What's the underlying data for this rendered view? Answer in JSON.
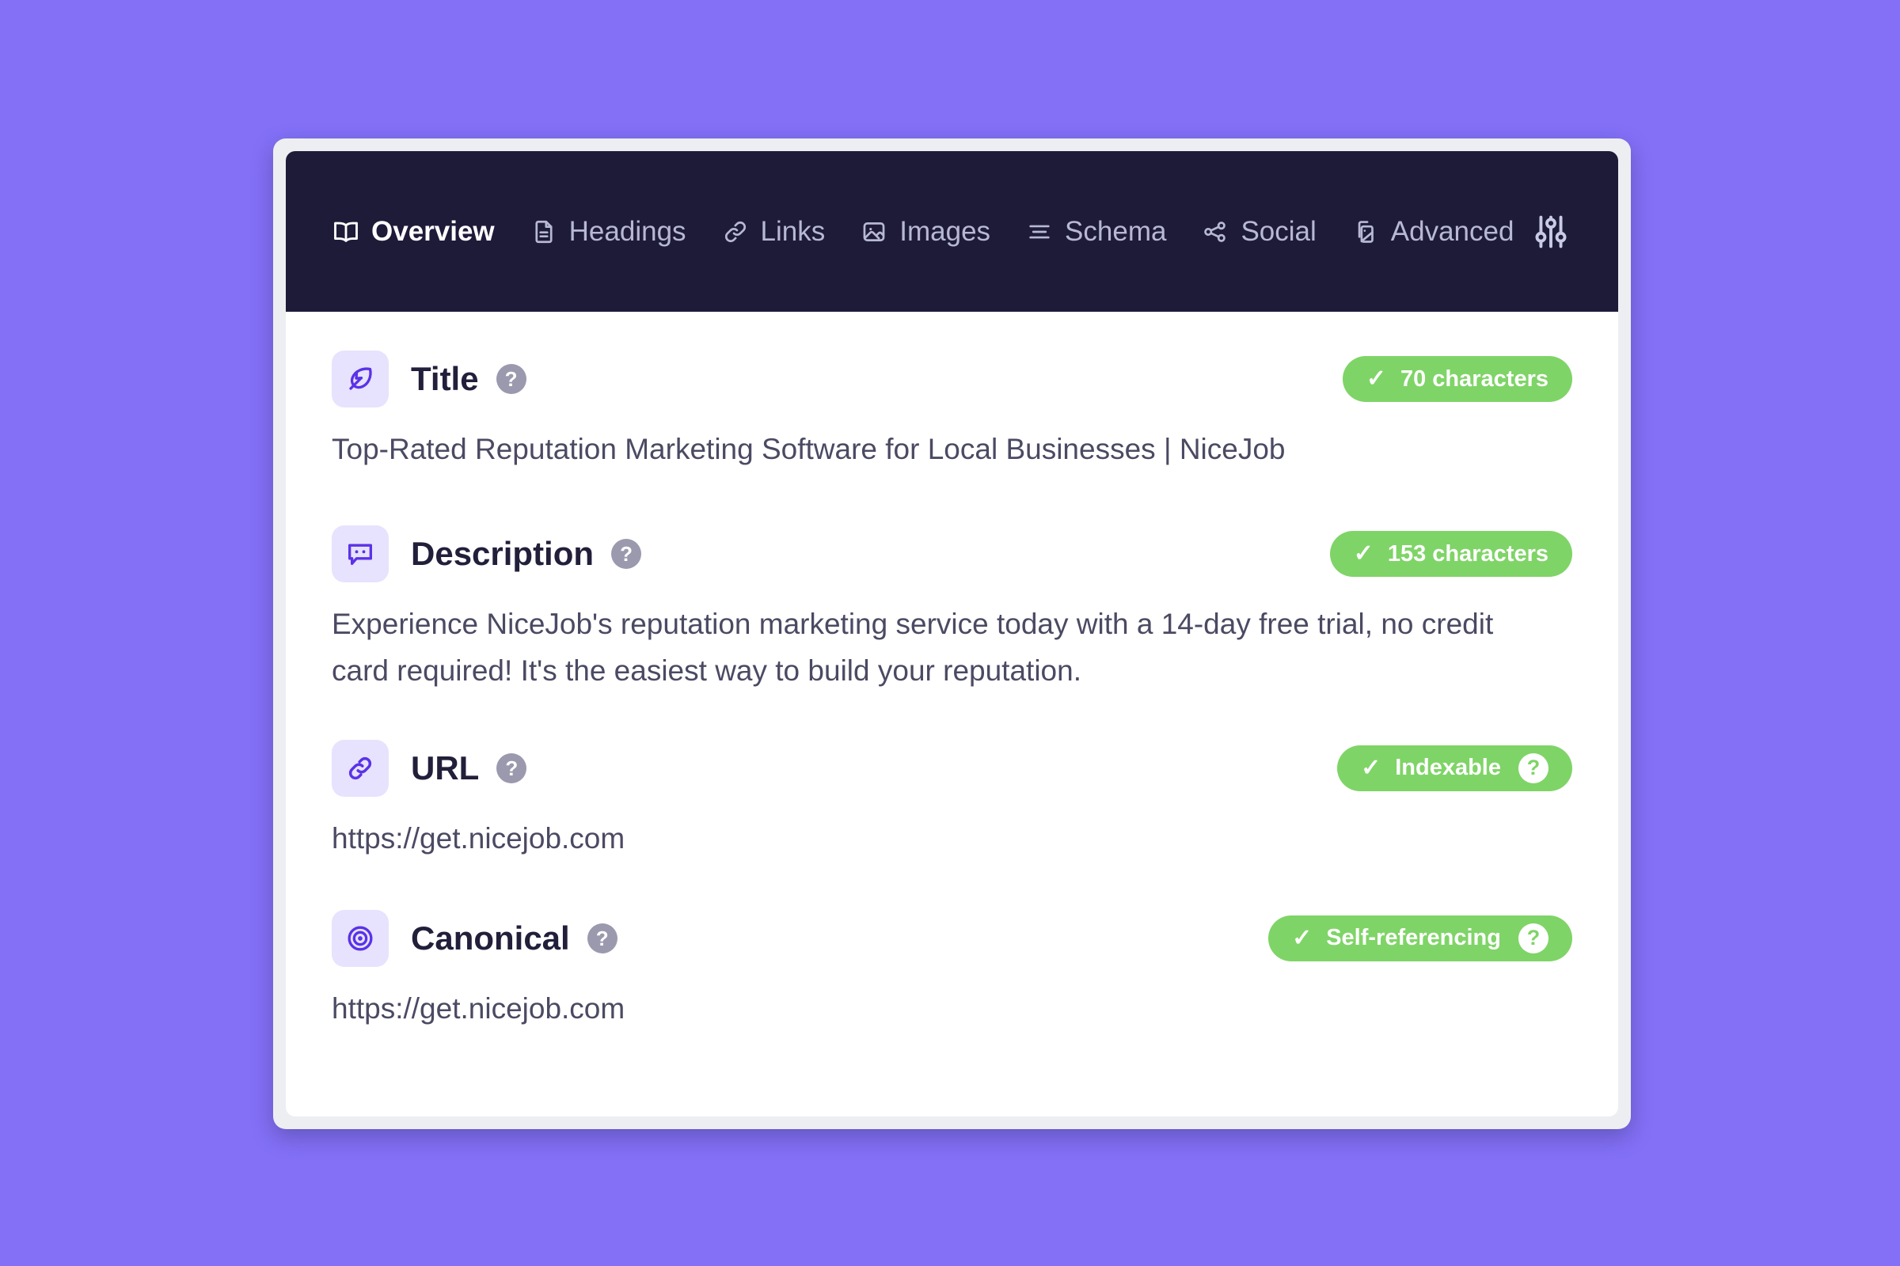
{
  "theme": {
    "page_background": "#8370F7",
    "frame_background": "#EDEEF1",
    "navbar_background": "#1E1B39",
    "panel_background": "#FFFFFF",
    "accent_purple": "#5A32E8",
    "tile_background": "#E7E2FD",
    "badge_green": "#7FD467",
    "help_gray": "#9B99AE"
  },
  "navbar": {
    "tabs": [
      {
        "label": "Overview",
        "icon": "book-open-icon",
        "active": true
      },
      {
        "label": "Headings",
        "icon": "document-icon",
        "active": false
      },
      {
        "label": "Links",
        "icon": "link-icon",
        "active": false
      },
      {
        "label": "Images",
        "icon": "image-icon",
        "active": false
      },
      {
        "label": "Schema",
        "icon": "list-lines-icon",
        "active": false
      },
      {
        "label": "Social",
        "icon": "share-network-icon",
        "active": false
      },
      {
        "label": "Advanced",
        "icon": "file-page-icon",
        "active": false
      }
    ],
    "settings_icon": "sliders-icon"
  },
  "sections": [
    {
      "key": "title",
      "title": "Title",
      "icon": "feather-icon",
      "help": "?",
      "badge": {
        "check": "✓",
        "label": "70 characters",
        "help": null
      },
      "body": "Top-Rated Reputation Marketing Software for Local Businesses | NiceJob"
    },
    {
      "key": "description",
      "title": "Description",
      "icon": "speech-bubble-icon",
      "help": "?",
      "badge": {
        "check": "✓",
        "label": "153 characters",
        "help": null
      },
      "body": "Experience NiceJob's reputation marketing service today with a 14-day free trial, no credit card required! It's the easiest way to build your reputation."
    },
    {
      "key": "url",
      "title": "URL",
      "icon": "chain-link-icon",
      "help": "?",
      "badge": {
        "check": "✓",
        "label": "Indexable",
        "help": "?"
      },
      "body": "https://get.nicejob.com"
    },
    {
      "key": "canonical",
      "title": "Canonical",
      "icon": "target-icon",
      "help": "?",
      "badge": {
        "check": "✓",
        "label": "Self-referencing",
        "help": "?"
      },
      "body": "https://get.nicejob.com"
    }
  ]
}
